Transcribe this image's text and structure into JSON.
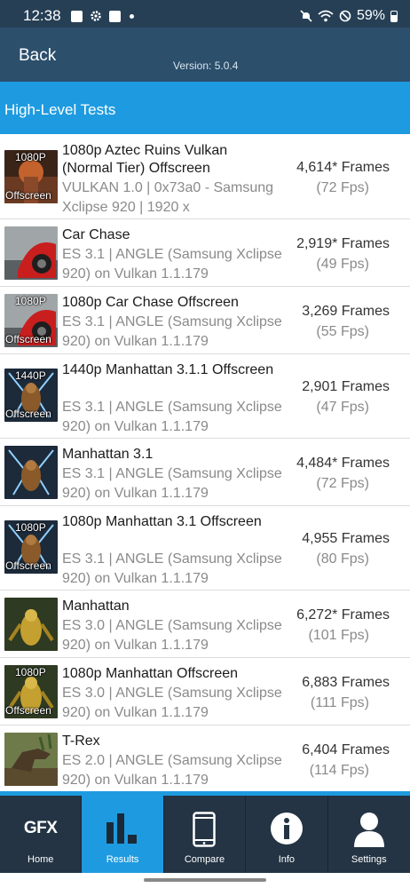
{
  "status_bar": {
    "time": "12:38",
    "battery": "59%"
  },
  "header": {
    "back_label": "Back",
    "version": "Version: 5.0.4"
  },
  "section": {
    "title": "High-Level Tests"
  },
  "results": [
    {
      "thumb_top": "1080P",
      "thumb_bottom": "Offscreen",
      "thumb_style": "aztec",
      "name": "1080p Aztec Ruins Vulkan (Normal Tier) Offscreen",
      "info": "VULKAN 1.0 | 0x73a0 - Samsung Xclipse 920 | 1920 x",
      "score": "4,614* Frames",
      "fps": "(72 Fps)"
    },
    {
      "thumb_top": "",
      "thumb_bottom": "",
      "thumb_style": "car",
      "name": "Car Chase",
      "info": "ES 3.1 | ANGLE (Samsung Xclipse 920) on Vulkan 1.1.179",
      "score": "2,919* Frames",
      "fps": "(49 Fps)"
    },
    {
      "thumb_top": "1080P",
      "thumb_bottom": "Offscreen",
      "thumb_style": "car",
      "name": "1080p Car Chase Offscreen",
      "info": "ES 3.1 | ANGLE (Samsung Xclipse 920) on Vulkan 1.1.179",
      "score": "3,269 Frames",
      "fps": "(55 Fps)"
    },
    {
      "thumb_top": "1440P",
      "thumb_bottom": "Offscreen",
      "thumb_style": "manhattan31",
      "name": "1440p Manhattan 3.1.1 Offscreen",
      "info": "ES 3.1 | ANGLE (Samsung Xclipse 920) on Vulkan 1.1.179",
      "score": "2,901 Frames",
      "fps": "(47 Fps)"
    },
    {
      "thumb_top": "",
      "thumb_bottom": "",
      "thumb_style": "manhattan31",
      "name": "Manhattan 3.1",
      "info": "ES 3.1 | ANGLE (Samsung Xclipse 920) on Vulkan 1.1.179",
      "score": "4,484* Frames",
      "fps": "(72 Fps)"
    },
    {
      "thumb_top": "1080P",
      "thumb_bottom": "Offscreen",
      "thumb_style": "manhattan31",
      "name": "1080p Manhattan 3.1 Offscreen",
      "info": "ES 3.1 | ANGLE (Samsung Xclipse 920) on Vulkan 1.1.179",
      "score": "4,955 Frames",
      "fps": "(80 Fps)"
    },
    {
      "thumb_top": "",
      "thumb_bottom": "",
      "thumb_style": "manhattan",
      "name": "Manhattan",
      "info": "ES 3.0 | ANGLE (Samsung Xclipse 920) on Vulkan 1.1.179",
      "score": "6,272* Frames",
      "fps": "(101 Fps)"
    },
    {
      "thumb_top": "1080P",
      "thumb_bottom": "Offscreen",
      "thumb_style": "manhattan",
      "name": "1080p Manhattan Offscreen",
      "info": "ES 3.0 | ANGLE (Samsung Xclipse 920) on Vulkan 1.1.179",
      "score": "6,883 Frames",
      "fps": "(111 Fps)"
    },
    {
      "thumb_top": "",
      "thumb_bottom": "",
      "thumb_style": "trex",
      "name": "T-Rex",
      "info": "ES 2.0 | ANGLE (Samsung Xclipse 920) on Vulkan 1.1.179",
      "score": "6,404 Frames",
      "fps": "(114 Fps)"
    }
  ],
  "nav": {
    "home": {
      "label": "Home",
      "logo": "GFX",
      "icon": "gfx-logo-icon"
    },
    "results": {
      "label": "Results",
      "icon": "bar-chart-icon"
    },
    "compare": {
      "label": "Compare",
      "icon": "phone-icon"
    },
    "info": {
      "label": "Info",
      "icon": "info-icon"
    },
    "settings": {
      "label": "Settings",
      "icon": "user-icon"
    }
  },
  "colors": {
    "accent": "#1e9be0",
    "header": "#2c4f6c",
    "status_bar": "#263f55",
    "nav": "#243444"
  }
}
